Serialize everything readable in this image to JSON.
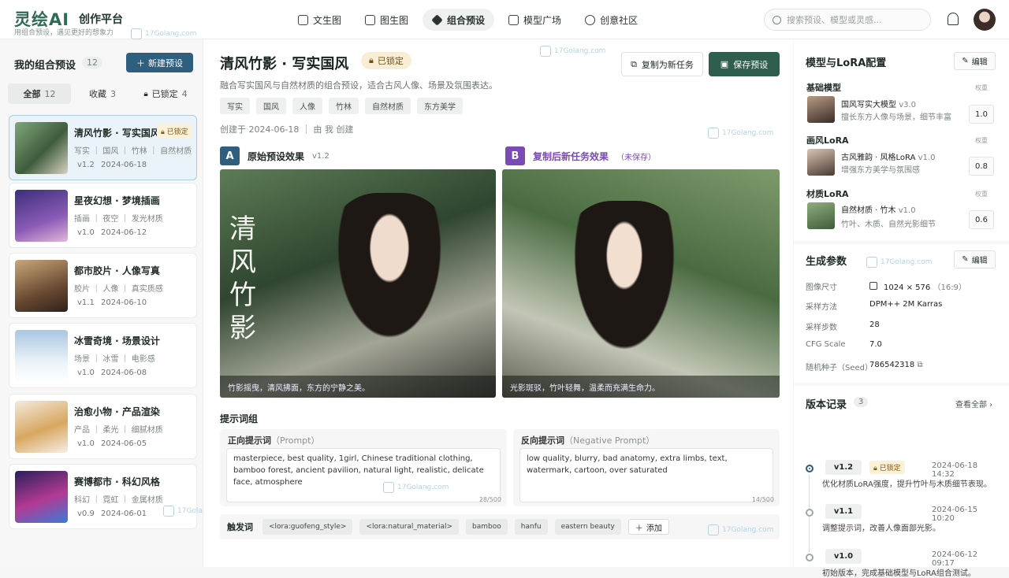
{
  "app": {
    "logo": "灵绘AI",
    "subtitle": "创作平台",
    "tagline": "用组合预设，遇见更好的想象力"
  },
  "nav": [
    {
      "label": "文生图"
    },
    {
      "label": "图生图"
    },
    {
      "label": "组合预设"
    },
    {
      "label": "模型广场"
    },
    {
      "label": "创意社区"
    }
  ],
  "search": {
    "placeholder": "搜索预设、模型或灵感..."
  },
  "watermark": "17Golang.com",
  "sidebar": {
    "title": "我的组合预设",
    "count": "12",
    "new_button": "新建预设",
    "filters": [
      {
        "label": "全部",
        "count": "12"
      },
      {
        "label": "收藏",
        "count": "3"
      },
      {
        "label": "已锁定",
        "count": "4"
      }
    ],
    "presets": [
      {
        "title": "清风竹影 · 写实国风",
        "tags": "写实 ｜ 国风 ｜ 竹林 ｜ 自然材质",
        "version": "v1.2",
        "date": "2024-06-18",
        "badge": "已锁定"
      },
      {
        "title": "星夜幻想 · 梦境插画",
        "tags": "插画 ｜ 夜空 ｜ 发光材质",
        "version": "v1.0",
        "date": "2024-06-12"
      },
      {
        "title": "都市胶片 · 人像写真",
        "tags": "胶片 ｜ 人像 ｜ 真实质感",
        "version": "v1.1",
        "date": "2024-06-10"
      },
      {
        "title": "冰雪奇境 · 场景设计",
        "tags": "场景 ｜ 冰雪 ｜ 电影感",
        "version": "v1.0",
        "date": "2024-06-08"
      },
      {
        "title": "治愈小物 · 产品渲染",
        "tags": "产品 ｜ 柔光 ｜ 细腻材质",
        "version": "v1.0",
        "date": "2024-06-05"
      },
      {
        "title": "赛博都市 · 科幻风格",
        "tags": "科幻 ｜ 霓虹 ｜ 金属材质",
        "version": "v0.9",
        "date": "2024-06-01"
      }
    ]
  },
  "main": {
    "title": "清风竹影 · 写实国风",
    "locked": "已锁定",
    "copy_button": "复制为新任务",
    "save_button": "保存预设",
    "description": "融合写实国风与自然材质的组合预设，适合古风人像、场景及氛围表达。",
    "tags": [
      "写实",
      "国风",
      "人像",
      "竹林",
      "自然材质",
      "东方美学"
    ],
    "meta": "创建于  2024-06-18    ｜  由 我 创建",
    "compare": {
      "a": {
        "letter": "A",
        "title": "原始预设效果",
        "version": "v1.2",
        "caption": "竹影摇曳，清风拂面，东方的宁静之美。",
        "art_text": "清风竹影"
      },
      "b": {
        "letter": "B",
        "title": "复制后新任务效果",
        "note": "（未保存）",
        "caption": "光影斑驳，竹叶轻舞，温柔而充满生命力。"
      }
    },
    "prompt_group": "提示词组",
    "positive": {
      "label": "正向提示词",
      "label_en": "（Prompt）",
      "text": "masterpiece, best quality, 1girl, Chinese traditional clothing, bamboo forest, ancient pavilion, natural light, realistic, delicate face, atmosphere",
      "count": "28/500"
    },
    "negative": {
      "label": "反向提示词",
      "label_en": "（Negative Prompt）",
      "text": "low quality, blurry, bad anatomy, extra limbs, text, watermark, cartoon, over saturated",
      "count": "14/500"
    },
    "triggers": {
      "label": "触发词",
      "items": [
        "<lora:guofeng_style>",
        "<lora:natural_material>",
        "bamboo",
        "hanfu",
        "eastern beauty"
      ],
      "add": "添加"
    }
  },
  "right": {
    "model_title": "模型与LoRA配置",
    "edit": "编辑",
    "weight_label": "权重",
    "base": {
      "label": "基础模型",
      "name": "国风写实大模型",
      "version": "v3.0",
      "desc": "擅长东方人像与场景，细节丰富",
      "value": "1.0"
    },
    "style": {
      "label": "画风LoRA",
      "name": "古风雅韵 · 风格LoRA",
      "version": "v1.0",
      "desc": "增强东方美学与氛围感",
      "value": "0.8"
    },
    "material": {
      "label": "材质LoRA",
      "name": "自然材质 · 竹木",
      "version": "v1.0",
      "desc": "竹叶、木质、自然光影细节",
      "value": "0.6"
    },
    "gen_title": "生成参数",
    "params": [
      {
        "k": "图像尺寸",
        "v": "1024 × 576",
        "extra": "（16:9）"
      },
      {
        "k": "采样方法",
        "v": "DPM++ 2M Karras"
      },
      {
        "k": "采样步数",
        "v": "28"
      },
      {
        "k": "CFG Scale",
        "v": "7.0"
      },
      {
        "k": "随机种子（Seed）",
        "v": "786542318"
      }
    ],
    "ver_title": "版本记录",
    "ver_count": "3",
    "view_all": "查看全部",
    "versions": [
      {
        "tag": "v1.2",
        "badge": "已锁定",
        "date": "2024-06-18 14:32",
        "note": "优化材质LoRA强度，提升竹叶与木质细节表现。"
      },
      {
        "tag": "v1.1",
        "date": "2024-06-15 10:20",
        "note": "调整提示词，改善人像面部光影。"
      },
      {
        "tag": "v1.0",
        "date": "2024-06-12 09:17",
        "note": "初始版本，完成基础模型与LoRA组合测试。"
      }
    ]
  }
}
